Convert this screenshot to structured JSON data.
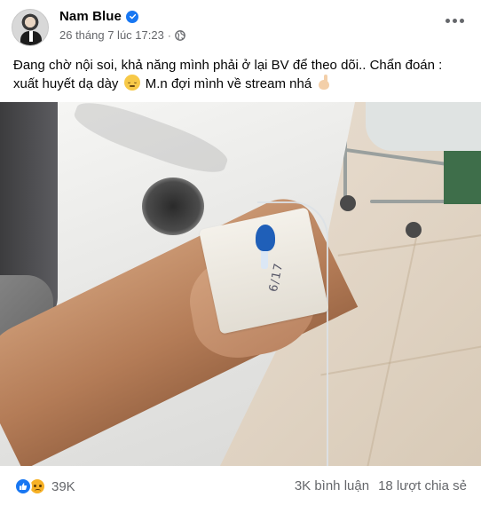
{
  "post": {
    "author": "Nam Blue",
    "verified": true,
    "timestamp": "26 tháng 7 lúc 17:23",
    "meta_separator": "·",
    "privacy_icon": "globe-icon",
    "more_icon": "more-options-icon",
    "text_part1": "Đang chờ nội soi, khả năng mình phải ở lại BV để theo dõi.. Chẩn đoán : xuất huyết dạ dày",
    "text_part2": "M.n đợi mình về stream nhá",
    "emoji_1": "pensive-face-emoji",
    "emoji_2": "ok-hand-emoji",
    "photo": {
      "description_icon": "hospital-iv-hand-photo",
      "tape_text": "6/17"
    }
  },
  "footer": {
    "reaction_icons": [
      "like-icon",
      "sad-icon"
    ],
    "reaction_count": "39K",
    "comments": "3K bình luận",
    "shares": "18 lượt chia sẻ"
  },
  "colors": {
    "brand_blue": "#1877f2",
    "secondary_text": "#65676b",
    "primary_text": "#050505"
  }
}
